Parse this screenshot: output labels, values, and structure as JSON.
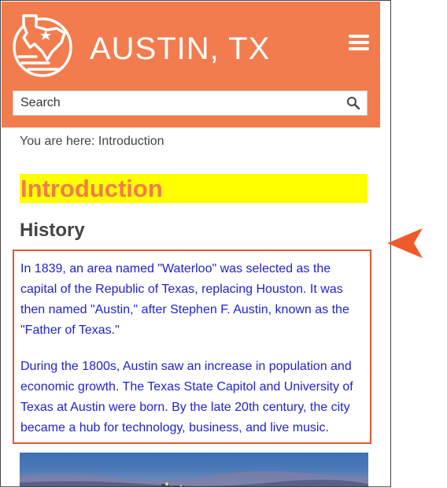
{
  "header": {
    "title": "AUSTIN, TX",
    "logo_icon": "texas-state-logo-icon",
    "menu_icon": "hamburger-menu-icon",
    "background": "#f27c4d"
  },
  "search": {
    "placeholder": "Search",
    "value": "",
    "icon": "search-icon"
  },
  "breadcrumb": {
    "text": "You are here: Introduction"
  },
  "main": {
    "heading": "Introduction",
    "heading_color": "#f27c4d",
    "heading_highlight": "#ffff00",
    "section_title": "History",
    "paragraphs": [
      "In 1839, an area named \"Waterloo\" was selected as the capital of the Republic of Texas, replacing Houston. It was then named \"Austin,\" after Stephen F. Austin, known as the \"Father of Texas.\"",
      "During the 1800s, Austin saw an increase in population and economic growth. The Texas State Capitol and University of Texas at Austin were born. By the late 20th century, the city became a hub for technology, business, and live music."
    ],
    "paragraph_color": "#2222cc",
    "box_border_color": "#e05a34"
  },
  "annotation": {
    "icon": "pointer-arrow-icon",
    "color": "#ef5b2b"
  }
}
